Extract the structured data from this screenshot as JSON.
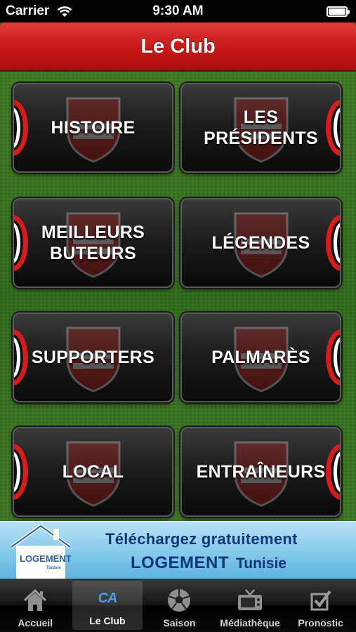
{
  "status_bar": {
    "carrier": "Carrier",
    "time": "9:30 AM"
  },
  "nav": {
    "title": "Le Club"
  },
  "tiles": [
    {
      "label": "HISTOIRE"
    },
    {
      "label": "LES\nPRÉSIDENTS"
    },
    {
      "label": "MEILLEURS\nBUTEURS"
    },
    {
      "label": "LÉGENDES"
    },
    {
      "label": "SUPPORTERS"
    },
    {
      "label": "PALMARÈS"
    },
    {
      "label": "LOCAL"
    },
    {
      "label": "ENTRAÎNEURS"
    }
  ],
  "ad": {
    "logo_main": "LOGEMENT",
    "logo_sub": "Tunisie",
    "line1": "Téléchargez gratuitement",
    "line2_brand": "LOGEMENT",
    "line2_country": "Tunisie"
  },
  "tabs": [
    {
      "label": "Accueil",
      "icon": "home-icon"
    },
    {
      "label": "Le Club",
      "icon": "ca-icon",
      "icon_text": "CA",
      "active": true
    },
    {
      "label": "Saison",
      "icon": "soccer-ball-icon"
    },
    {
      "label": "Médiathèque",
      "icon": "tv-icon"
    },
    {
      "label": "Pronostic",
      "icon": "checkbox-icon"
    }
  ],
  "colors": {
    "nav_red": "#c81616",
    "ring_red": "#d81b1b",
    "ad_text": "#10367a",
    "tab_active_icon": "#4d9de6"
  }
}
